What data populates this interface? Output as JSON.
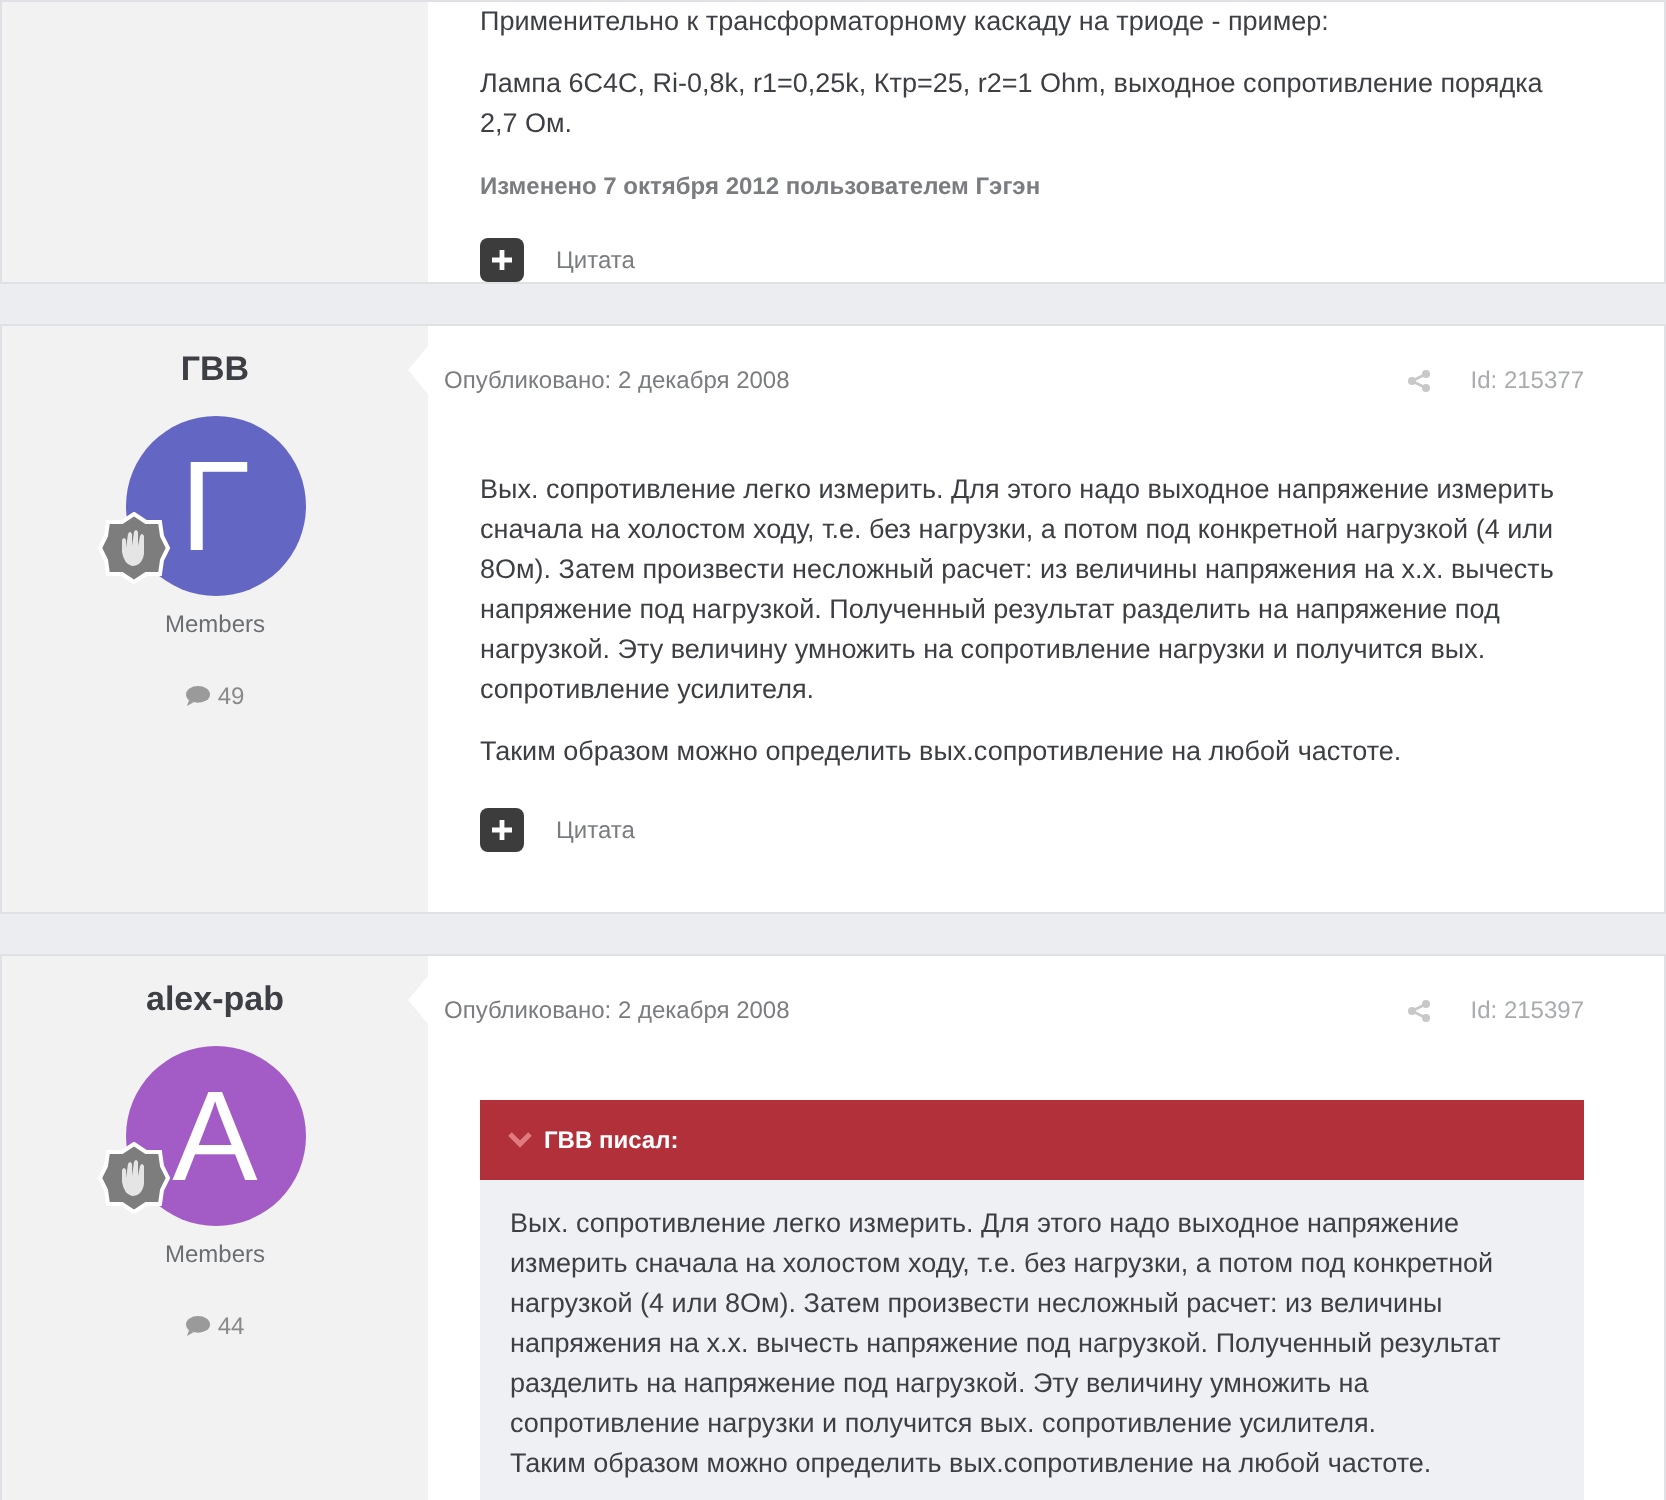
{
  "posts": [
    {
      "paragraphs": [
        "Применительно к трансформаторному каскаду на триоде - пример:",
        "Лампа 6С4С, Ri-0,8k, r1=0,25k, Ктр=25, r2=1 Ohm, выходное сопротивление порядка 2,7 Ом."
      ],
      "edited_note": "Изменено 7 октября 2012 пользователем Гэгэн",
      "quote_button": "Цитата"
    },
    {
      "author": {
        "name": "ГВВ",
        "avatar_letter": "Г",
        "color": "#6466c4",
        "group": "Members",
        "post_count": "49"
      },
      "date": "Опубликовано: 2 декабря 2008",
      "post_id": "Id: 215377",
      "paragraphs": [
        "Вых. сопротивление легко измерить. Для этого надо выходное напряжение измерить сначала на холостом ходу, т.е. без нагрузки, а потом под конкретной нагрузкой (4 или 8Ом). Затем произвести несложный расчет: из величины напряжения на х.х. вычесть напряжение под нагрузкой. Полученный результат разделить на напряжение под нагрузкой. Эту величину умножить на сопротивление нагрузки и получится вых. сопротивление усилителя.",
        "Таким образом можно определить вых.сопротивление на любой частоте."
      ],
      "quote_button": "Цитата"
    },
    {
      "author": {
        "name": "alex-pab",
        "avatar_letter": "A",
        "color": "#a35bc6",
        "group": "Members",
        "post_count": "44"
      },
      "date": "Опубликовано: 2 декабря 2008",
      "post_id": "Id: 215397",
      "quote": {
        "header": "ГВВ писал:",
        "lines": [
          "Вых. сопротивление легко измерить. Для этого надо выходное напряжение измерить сначала на холостом ходу, т.е. без нагрузки, а потом под конкретной нагрузкой (4 или 8Ом). Затем произвести несложный расчет: из величины напряжения на х.х. вычесть напряжение под нагрузкой. Полученный результат разделить на напряжение под нагрузкой. Эту величину умножить на сопротивление нагрузки и получится вых. сопротивление усилителя.",
          "Таким образом можно определить вых.сопротивление на любой частоте."
        ]
      }
    }
  ]
}
